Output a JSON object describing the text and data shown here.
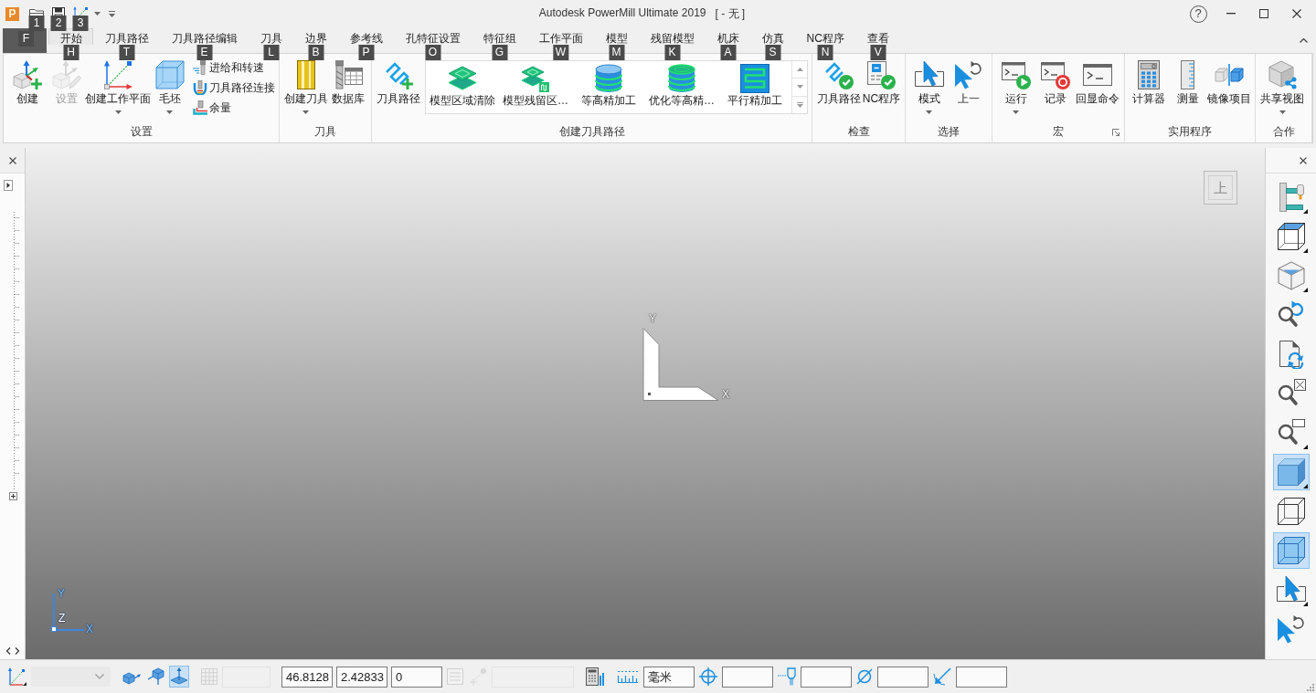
{
  "title_bar": {
    "app_icon": "P",
    "quick_access": [
      {
        "keytip": "1"
      },
      {
        "keytip": "2"
      },
      {
        "keytip": "3"
      }
    ],
    "title": "Autodesk PowerMill Ultimate 2019",
    "document": "[ - 无 ]",
    "help": "?"
  },
  "file_tab": {
    "keytip": "F"
  },
  "tabs": [
    {
      "label": "开始",
      "keytip": "H",
      "selected": true
    },
    {
      "label": "刀具路径",
      "keytip": "T",
      "selected": false
    },
    {
      "label": "刀具路径编辑",
      "keytip": "E",
      "selected": false
    },
    {
      "label": "刀具",
      "keytip": "L",
      "selected": false
    },
    {
      "label": "边界",
      "keytip": "B",
      "selected": false
    },
    {
      "label": "参考线",
      "keytip": "P",
      "selected": false
    },
    {
      "label": "孔特征设置",
      "keytip": "O",
      "selected": false
    },
    {
      "label": "特征组",
      "keytip": "G",
      "selected": false
    },
    {
      "label": "工作平面",
      "keytip": "W",
      "selected": false
    },
    {
      "label": "模型",
      "keytip": "M",
      "selected": false
    },
    {
      "label": "残留模型",
      "keytip": "K",
      "selected": false
    },
    {
      "label": "机床",
      "keytip": "A",
      "selected": false
    },
    {
      "label": "仿真",
      "keytip": "S",
      "selected": false
    },
    {
      "label": "NC程序",
      "keytip": "N",
      "selected": false
    },
    {
      "label": "查看",
      "keytip": "V",
      "selected": false
    }
  ],
  "ribbon": {
    "groups": [
      {
        "label": "设置",
        "launcher": false,
        "items": [
          {
            "kind": "large",
            "label": "创建",
            "dropdown": false,
            "disabled": false
          },
          {
            "kind": "large",
            "label": "设置",
            "dropdown": false,
            "disabled": true
          },
          {
            "kind": "large",
            "label": "创建工作平面",
            "dropdown": true,
            "disabled": false
          },
          {
            "kind": "large",
            "label": "毛坯",
            "dropdown": true,
            "disabled": false
          },
          {
            "kind": "small",
            "label": "进给和转速",
            "disabled": false
          },
          {
            "kind": "small",
            "label": "刀具路径连接",
            "disabled": false
          },
          {
            "kind": "small",
            "label": "余量",
            "disabled": false
          }
        ]
      },
      {
        "label": "刀具",
        "launcher": false,
        "items": [
          {
            "kind": "large",
            "label": "创建刀具",
            "dropdown": true,
            "disabled": false
          },
          {
            "kind": "large",
            "label": "数据库",
            "dropdown": false,
            "disabled": false
          }
        ]
      },
      {
        "label": "创建刀具路径",
        "launcher": false,
        "items": [
          {
            "kind": "large",
            "label": "刀具路径",
            "dropdown": false,
            "disabled": false
          },
          {
            "kind": "gallery",
            "disabled": false,
            "entries": [
              {
                "label": "模型区域清除"
              },
              {
                "label": "模型残留区…"
              },
              {
                "label": "等高精加工"
              },
              {
                "label": "优化等高精…"
              },
              {
                "label": "平行精加工"
              }
            ]
          }
        ]
      },
      {
        "label": "检查",
        "launcher": false,
        "items": [
          {
            "kind": "large",
            "label": "刀具路径",
            "dropdown": false,
            "disabled": false
          },
          {
            "kind": "large",
            "label": "NC程序",
            "dropdown": false,
            "disabled": false
          }
        ]
      },
      {
        "label": "选择",
        "launcher": false,
        "items": [
          {
            "kind": "large",
            "label": "模式",
            "dropdown": true,
            "disabled": false
          },
          {
            "kind": "large",
            "label": "上一",
            "dropdown": false,
            "disabled": false
          }
        ]
      },
      {
        "label": "宏",
        "launcher": true,
        "items": [
          {
            "kind": "large",
            "label": "运行",
            "dropdown": true,
            "disabled": false
          },
          {
            "kind": "large",
            "label": "记录",
            "dropdown": false,
            "disabled": false
          },
          {
            "kind": "large",
            "label": "回显命令",
            "dropdown": false,
            "disabled": false
          }
        ]
      },
      {
        "label": "实用程序",
        "launcher": false,
        "items": [
          {
            "kind": "large",
            "label": "计算器",
            "dropdown": false,
            "disabled": false
          },
          {
            "kind": "large",
            "label": "测量",
            "dropdown": false,
            "disabled": false
          },
          {
            "kind": "large",
            "label": "镜像项目",
            "dropdown": false,
            "disabled": false
          }
        ]
      },
      {
        "label": "合作",
        "launcher": false,
        "items": [
          {
            "kind": "large",
            "label": "共享视图",
            "dropdown": true,
            "disabled": false
          }
        ]
      }
    ]
  },
  "viewport": {
    "view_cube": {
      "label": "上"
    },
    "triad": {
      "y_label": "Y",
      "x_label": "X"
    },
    "mini_triad": {
      "y_label": "Y",
      "z_label": "Z",
      "x_label": "X"
    }
  },
  "right_toolbar": {
    "items": [
      {
        "selected": false,
        "dropdown": true
      },
      {
        "selected": false,
        "dropdown": true
      },
      {
        "selected": false,
        "dropdown": true
      },
      {
        "selected": false,
        "dropdown": false
      },
      {
        "selected": false,
        "dropdown": false
      },
      {
        "selected": false,
        "dropdown": false
      },
      {
        "selected": false,
        "dropdown": true
      },
      {
        "selected": true,
        "dropdown": true
      },
      {
        "selected": false,
        "dropdown": false
      },
      {
        "selected": true,
        "dropdown": false
      },
      {
        "selected": false,
        "dropdown": true
      },
      {
        "selected": false,
        "dropdown": false
      }
    ]
  },
  "status_bar": {
    "groups": [
      {
        "items": [
          {
            "kind": "button",
            "selected": false,
            "disabled": false
          },
          {
            "kind": "combo",
            "disabled": true
          }
        ]
      },
      {
        "items": [
          {
            "kind": "button",
            "selected": false,
            "disabled": false
          },
          {
            "kind": "button",
            "selected": false,
            "disabled": false
          },
          {
            "kind": "button",
            "selected": true,
            "disabled": false
          }
        ]
      },
      {
        "items": [
          {
            "kind": "button",
            "selected": false,
            "disabled": true
          },
          {
            "kind": "field",
            "disabled": true
          }
        ]
      },
      {
        "items": [
          {
            "kind": "field",
            "value": "46.8128",
            "disabled": false
          },
          {
            "kind": "field",
            "value": "2.42833",
            "disabled": false
          },
          {
            "kind": "field",
            "value": "0",
            "disabled": false
          },
          {
            "kind": "button",
            "selected": false,
            "disabled": true
          },
          {
            "kind": "button",
            "selected": false,
            "disabled": true
          },
          {
            "kind": "field",
            "disabled": true
          }
        ]
      },
      {
        "items": [
          {
            "kind": "button",
            "selected": false,
            "disabled": false
          }
        ]
      },
      {
        "items": [
          {
            "kind": "button",
            "selected": false,
            "disabled": false
          },
          {
            "kind": "field",
            "value": "毫米",
            "disabled": false
          },
          {
            "kind": "button",
            "selected": false,
            "disabled": false
          },
          {
            "kind": "field",
            "disabled": false
          },
          {
            "kind": "button",
            "selected": false,
            "disabled": false
          },
          {
            "kind": "field",
            "disabled": false
          },
          {
            "kind": "button",
            "selected": false,
            "disabled": false
          },
          {
            "kind": "field",
            "disabled": false
          },
          {
            "kind": "button",
            "selected": false,
            "disabled": false
          },
          {
            "kind": "field",
            "disabled": false
          }
        ]
      }
    ]
  }
}
